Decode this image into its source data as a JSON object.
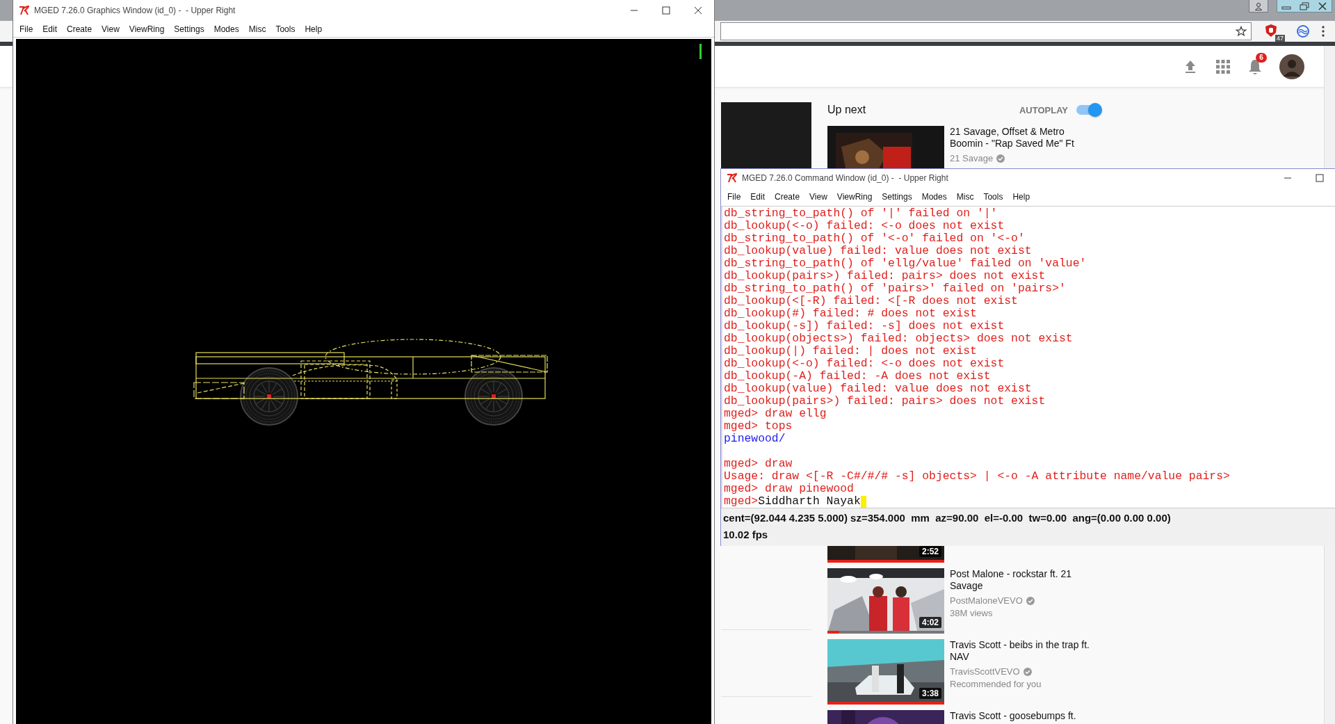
{
  "browser": {
    "extension_badge": "47"
  },
  "youtube": {
    "notification_count": "6",
    "up_next": "Up next",
    "autoplay": {
      "label": "AUTOPLAY",
      "on": true
    },
    "videos": [
      {
        "title": "21 Savage, Offset & Metro Boomin - \"Rap Saved Me\" Ft",
        "channel": "21 Savage",
        "verified": true
      },
      {
        "duration": "2:52",
        "level": 1
      },
      {
        "title": "Post Malone - rockstar ft. 21 Savage",
        "channel": "PostMaloneVEVO",
        "verified": true,
        "meta": "38M views",
        "duration": "4:02",
        "level": 0.1
      },
      {
        "title": "Travis Scott - beibs in the trap ft. NAV",
        "channel": "TravisScottVEVO",
        "verified": true,
        "meta": "Recommended for you",
        "duration": "3:38",
        "level": 1
      },
      {
        "title": "Travis Scott - goosebumps ft."
      }
    ]
  },
  "graphics_window": {
    "title": "MGED 7.26.0 Graphics Window (id_0) -  - Upper Right",
    "menu": [
      "File",
      "Edit",
      "Create",
      "View",
      "ViewRing",
      "Settings",
      "Modes",
      "Misc",
      "Tools",
      "Help"
    ]
  },
  "command_window": {
    "title": "MGED 7.26.0 Command Window (id_0) -  - Upper Right",
    "menu": [
      "File",
      "Edit",
      "Create",
      "View",
      "ViewRing",
      "Settings",
      "Modes",
      "Misc",
      "Tools",
      "Help"
    ],
    "lines": [
      {
        "kind": "error",
        "text": "db_string_to_path() of '|' failed on '|'"
      },
      {
        "kind": "error",
        "text": "db_lookup(<-o) failed: <-o does not exist"
      },
      {
        "kind": "error",
        "text": "db_string_to_path() of '<-o' failed on '<-o'"
      },
      {
        "kind": "error",
        "text": "db_lookup(value) failed: value does not exist"
      },
      {
        "kind": "error",
        "text": "db_string_to_path() of 'ellg/value' failed on 'value'"
      },
      {
        "kind": "error",
        "text": "db_lookup(pairs>) failed: pairs> does not exist"
      },
      {
        "kind": "error",
        "text": "db_string_to_path() of 'pairs>' failed on 'pairs>'"
      },
      {
        "kind": "error",
        "text": "db_lookup(<[-R) failed: <[-R does not exist"
      },
      {
        "kind": "error",
        "text": "db_lookup(#) failed: # does not exist"
      },
      {
        "kind": "error",
        "text": "db_lookup(-s]) failed: -s] does not exist"
      },
      {
        "kind": "error",
        "text": "db_lookup(objects>) failed: objects> does not exist"
      },
      {
        "kind": "error",
        "text": "db_lookup(|) failed: | does not exist"
      },
      {
        "kind": "error",
        "text": "db_lookup(<-o) failed: <-o does not exist"
      },
      {
        "kind": "error",
        "text": "db_lookup(-A) failed: -A does not exist"
      },
      {
        "kind": "error",
        "text": "db_lookup(value) failed: value does not exist"
      },
      {
        "kind": "error",
        "text": "db_lookup(pairs>) failed: pairs> does not exist"
      },
      {
        "kind": "prompt",
        "prompt": "mged>",
        "text": "draw ellg"
      },
      {
        "kind": "prompt",
        "prompt": "mged>",
        "text": "tops"
      },
      {
        "kind": "result",
        "text": "pinewood/"
      },
      {
        "kind": "blank"
      },
      {
        "kind": "prompt",
        "prompt": "mged>",
        "text": "draw"
      },
      {
        "kind": "error",
        "text": "Usage: draw <[-R -C#/#/# -s] objects> | <-o -A attribute name/value pairs>"
      },
      {
        "kind": "prompt",
        "prompt": "mged>",
        "text": "draw pinewood"
      },
      {
        "kind": "input",
        "prompt": "mged>",
        "text": "Siddharth Nayak"
      }
    ],
    "status": {
      "view": "cent=(92.044 4.235 5.000) sz=354.000  mm  az=90.00  el=-0.00  tw=0.00  ang=(0.00 0.00 0.00)",
      "fps": "10.02 fps"
    }
  }
}
